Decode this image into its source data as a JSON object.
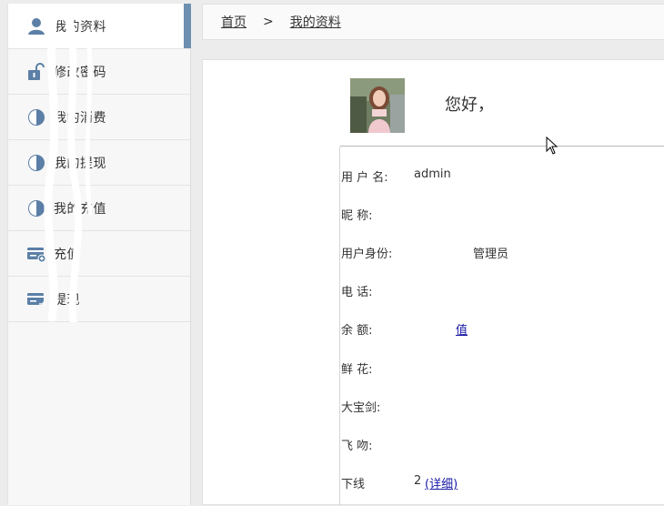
{
  "sidebar": {
    "items": [
      {
        "label": "我的资料",
        "icon": "user-icon",
        "active": true
      },
      {
        "label": "修改密码",
        "icon": "lock-icon",
        "active": false
      },
      {
        "label": "我的消费",
        "icon": "pie-chart-icon",
        "active": false
      },
      {
        "label": "我的提现",
        "icon": "pie-chart-icon",
        "active": false
      },
      {
        "label": "我的充值",
        "icon": "pie-chart-icon",
        "active": false
      },
      {
        "label": "充值",
        "icon": "card-add-icon",
        "active": false
      },
      {
        "label": "提现",
        "icon": "card-out-icon",
        "active": false
      }
    ]
  },
  "breadcrumb": {
    "home": "首页",
    "separator": ">",
    "current": "我的资料"
  },
  "profile": {
    "greeting": "您好，",
    "rows": [
      {
        "label": "用 户 名:",
        "value": "admin"
      },
      {
        "label": "昵 称:",
        "value": ""
      },
      {
        "label": "用户身份:",
        "value": "管理员"
      },
      {
        "label": "电 话:",
        "value": ""
      },
      {
        "label": "余 额:",
        "value": "",
        "link": "值"
      },
      {
        "label": "鲜 花:",
        "value": ""
      },
      {
        "label": "大宝剑:",
        "value": ""
      },
      {
        "label": "飞 吻:",
        "value": ""
      },
      {
        "label": "下线",
        "value": "2",
        "link": "(详细)"
      }
    ]
  },
  "colors": {
    "accent": "#6d8fb0",
    "icon": "#5b7fa6",
    "link": "#1a1aa6"
  }
}
